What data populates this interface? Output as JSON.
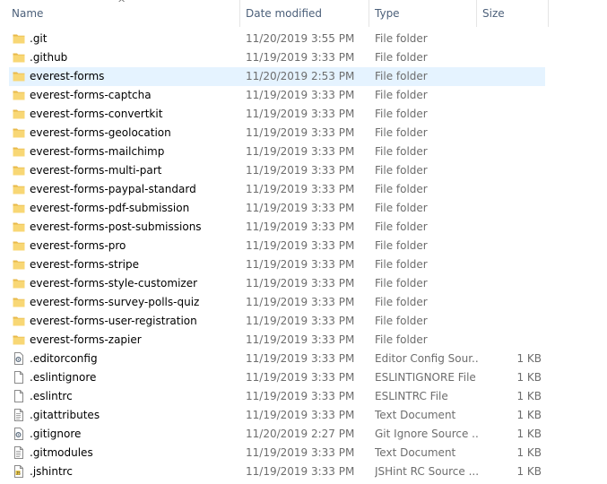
{
  "columns": {
    "name": "Name",
    "date": "Date modified",
    "type": "Type",
    "size": "Size"
  },
  "sort_indicator": "^",
  "selected_index": 2,
  "files": [
    {
      "name": ".git",
      "date": "11/20/2019 3:55 PM",
      "type": "File folder",
      "size": "",
      "icon": "folder-icon"
    },
    {
      "name": ".github",
      "date": "11/19/2019 3:33 PM",
      "type": "File folder",
      "size": "",
      "icon": "folder-icon"
    },
    {
      "name": "everest-forms",
      "date": "11/20/2019 2:53 PM",
      "type": "File folder",
      "size": "",
      "icon": "folder-icon"
    },
    {
      "name": "everest-forms-captcha",
      "date": "11/19/2019 3:33 PM",
      "type": "File folder",
      "size": "",
      "icon": "folder-icon"
    },
    {
      "name": "everest-forms-convertkit",
      "date": "11/19/2019 3:33 PM",
      "type": "File folder",
      "size": "",
      "icon": "folder-icon"
    },
    {
      "name": "everest-forms-geolocation",
      "date": "11/19/2019 3:33 PM",
      "type": "File folder",
      "size": "",
      "icon": "folder-icon"
    },
    {
      "name": "everest-forms-mailchimp",
      "date": "11/19/2019 3:33 PM",
      "type": "File folder",
      "size": "",
      "icon": "folder-icon"
    },
    {
      "name": "everest-forms-multi-part",
      "date": "11/19/2019 3:33 PM",
      "type": "File folder",
      "size": "",
      "icon": "folder-icon"
    },
    {
      "name": "everest-forms-paypal-standard",
      "date": "11/19/2019 3:33 PM",
      "type": "File folder",
      "size": "",
      "icon": "folder-icon"
    },
    {
      "name": "everest-forms-pdf-submission",
      "date": "11/19/2019 3:33 PM",
      "type": "File folder",
      "size": "",
      "icon": "folder-icon"
    },
    {
      "name": "everest-forms-post-submissions",
      "date": "11/19/2019 3:33 PM",
      "type": "File folder",
      "size": "",
      "icon": "folder-icon"
    },
    {
      "name": "everest-forms-pro",
      "date": "11/19/2019 3:33 PM",
      "type": "File folder",
      "size": "",
      "icon": "folder-icon"
    },
    {
      "name": "everest-forms-stripe",
      "date": "11/19/2019 3:33 PM",
      "type": "File folder",
      "size": "",
      "icon": "folder-icon"
    },
    {
      "name": "everest-forms-style-customizer",
      "date": "11/19/2019 3:33 PM",
      "type": "File folder",
      "size": "",
      "icon": "folder-icon"
    },
    {
      "name": "everest-forms-survey-polls-quiz",
      "date": "11/19/2019 3:33 PM",
      "type": "File folder",
      "size": "",
      "icon": "folder-icon"
    },
    {
      "name": "everest-forms-user-registration",
      "date": "11/19/2019 3:33 PM",
      "type": "File folder",
      "size": "",
      "icon": "folder-icon"
    },
    {
      "name": "everest-forms-zapier",
      "date": "11/19/2019 3:33 PM",
      "type": "File folder",
      "size": "",
      "icon": "folder-icon"
    },
    {
      "name": ".editorconfig",
      "date": "11/19/2019 3:33 PM",
      "type": "Editor Config Sour...",
      "size": "1 KB",
      "icon": "config-file-icon"
    },
    {
      "name": ".eslintignore",
      "date": "11/19/2019 3:33 PM",
      "type": "ESLINTIGNORE File",
      "size": "1 KB",
      "icon": "blank-file-icon"
    },
    {
      "name": ".eslintrc",
      "date": "11/19/2019 3:33 PM",
      "type": "ESLINTRC File",
      "size": "1 KB",
      "icon": "blank-file-icon"
    },
    {
      "name": ".gitattributes",
      "date": "11/19/2019 3:33 PM",
      "type": "Text Document",
      "size": "1 KB",
      "icon": "text-file-icon"
    },
    {
      "name": ".gitignore",
      "date": "11/20/2019 2:27 PM",
      "type": "Git Ignore Source ...",
      "size": "1 KB",
      "icon": "config-file-icon"
    },
    {
      "name": ".gitmodules",
      "date": "11/19/2019 3:33 PM",
      "type": "Text Document",
      "size": "1 KB",
      "icon": "text-file-icon"
    },
    {
      "name": ".jshintrc",
      "date": "11/19/2019 3:33 PM",
      "type": "JSHint RC Source ...",
      "size": "1 KB",
      "icon": "script-file-icon"
    }
  ],
  "colors": {
    "folder": "#f8d775",
    "folder_dark": "#e8b949",
    "header_text": "#4c607a",
    "selected_row": "#e5f3ff",
    "secondary_text": "#6d6d6d"
  }
}
